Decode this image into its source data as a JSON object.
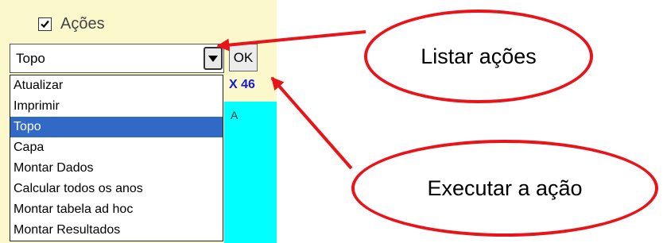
{
  "panel": {
    "checkbox": {
      "label": "Ações",
      "checked": true
    },
    "combo": {
      "value": "Topo"
    },
    "ok_button": {
      "label": "OK"
    },
    "dropdown": {
      "items": [
        "Atualizar",
        "Imprimir",
        "Topo",
        "Capa",
        "Montar Dados",
        "Calcular todos os anos",
        "Montar tabela ad hoc",
        "Montar Resultados"
      ],
      "selected": "Topo"
    },
    "side_label": "X 46",
    "side_text": "A"
  },
  "callouts": {
    "list_actions": "Listar ações",
    "execute_action": "Executar a ação"
  },
  "colors": {
    "panel_bg": "#fbf8cc",
    "cyan": "#00ffff",
    "selection": "#3169c6",
    "callout_red": "#e8141a",
    "side_label": "#1818d8"
  }
}
